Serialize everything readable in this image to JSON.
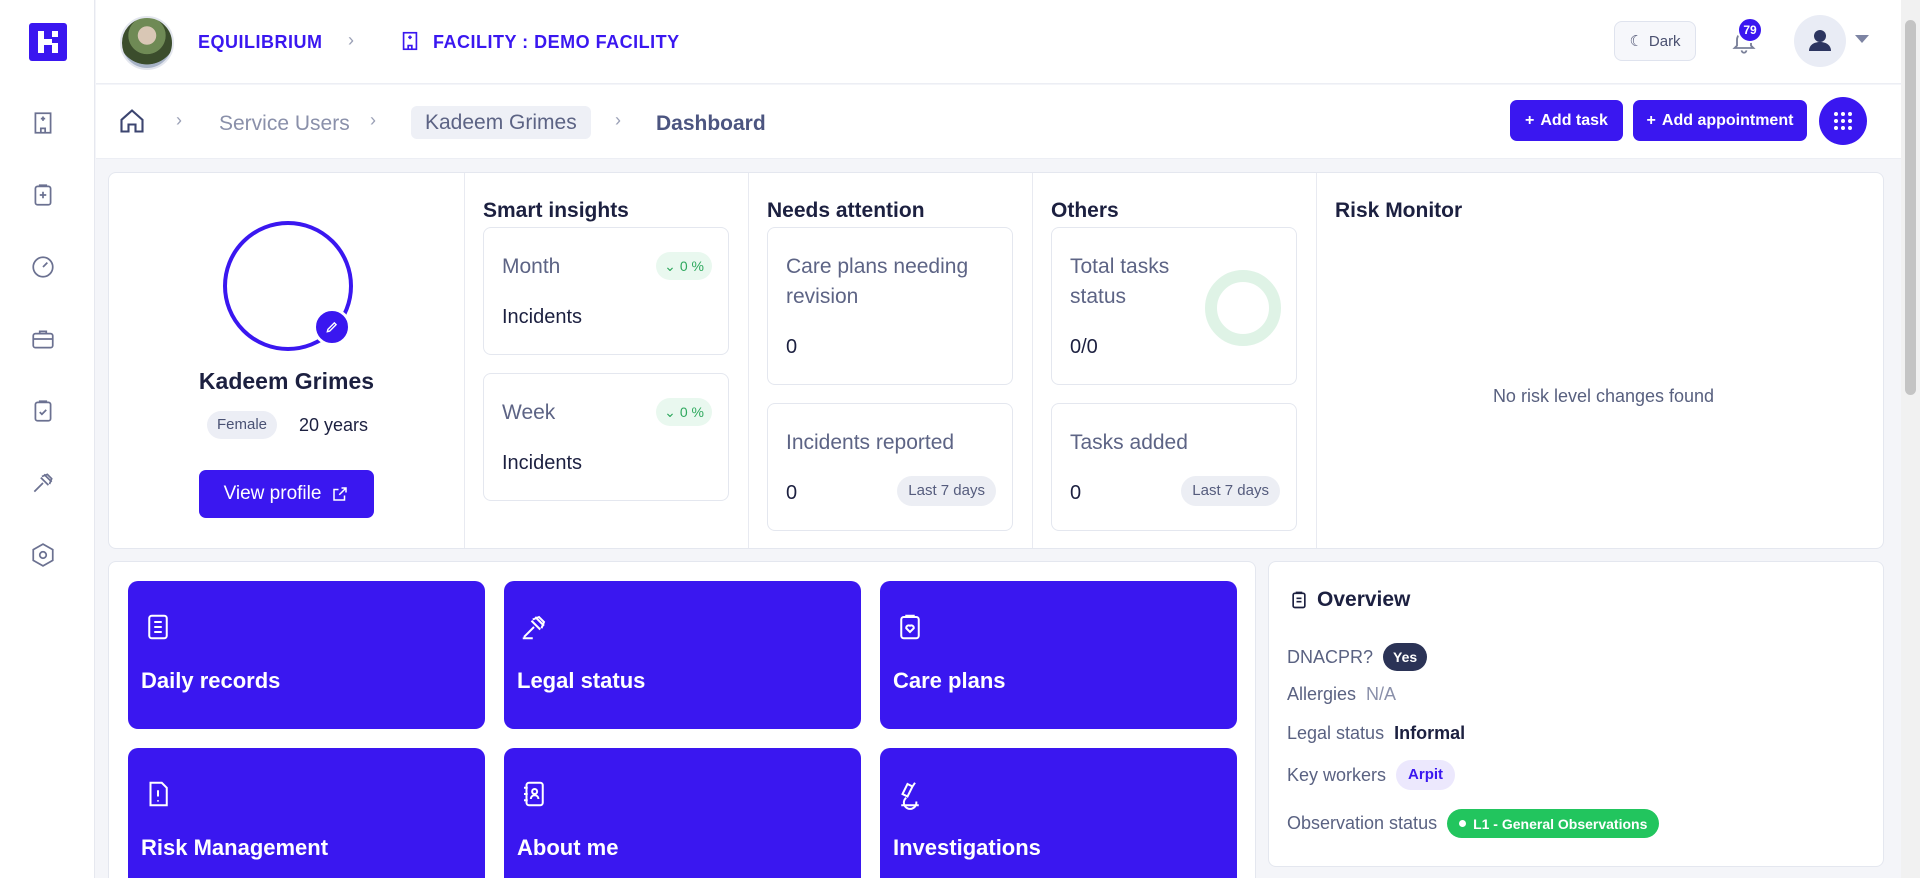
{
  "topbar": {
    "org_name": "EQUILIBRIUM",
    "facility_label": "FACILITY : DEMO FACILITY",
    "theme_label": "Dark",
    "notification_count": "79"
  },
  "breadcrumb": {
    "service_users": "Service Users",
    "user_name": "Kadeem Grimes",
    "current": "Dashboard"
  },
  "actions": {
    "add_task": "Add task",
    "add_appointment": "Add appointment"
  },
  "profile": {
    "name": "Kadeem Grimes",
    "gender": "Female",
    "age": "20 years",
    "view_profile": "View profile"
  },
  "smart_insights": {
    "title": "Smart insights",
    "month": {
      "period": "Month",
      "metric": "Incidents",
      "change": "0 %"
    },
    "week": {
      "period": "Week",
      "metric": "Incidents",
      "change": "0 %"
    }
  },
  "needs_attention": {
    "title": "Needs attention",
    "care_plans": {
      "label": "Care plans needing revision",
      "value": "0"
    },
    "incidents": {
      "label": "Incidents reported",
      "value": "0",
      "range": "Last 7 days"
    }
  },
  "others": {
    "title": "Others",
    "total_tasks": {
      "label": "Total tasks status",
      "value": "0/0"
    },
    "tasks_added": {
      "label": "Tasks added",
      "value": "0",
      "range": "Last 7 days"
    }
  },
  "risk_monitor": {
    "title": "Risk Monitor",
    "empty": "No risk level changes found"
  },
  "tiles": [
    {
      "label": "Daily records",
      "icon": "document-icon"
    },
    {
      "label": "Legal status",
      "icon": "gavel-icon"
    },
    {
      "label": "Care plans",
      "icon": "clipboard-heart-icon"
    },
    {
      "label": "Risk Management",
      "icon": "document-alert-icon"
    },
    {
      "label": "About me",
      "icon": "contact-book-icon"
    },
    {
      "label": "Investigations",
      "icon": "microscope-icon"
    }
  ],
  "overview": {
    "title": "Overview",
    "dnacpr_label": "DNACPR?",
    "dnacpr_value": "Yes",
    "allergies_label": "Allergies",
    "allergies_value": "N/A",
    "legal_label": "Legal status",
    "legal_value": "Informal",
    "key_workers_label": "Key workers",
    "key_worker": "Arpit",
    "observation_label": "Observation status",
    "observation_value": "L1 - General Observations"
  },
  "colors": {
    "brand": "#3a17f0",
    "success": "#22c55e",
    "dark_pill": "#2b3356"
  }
}
